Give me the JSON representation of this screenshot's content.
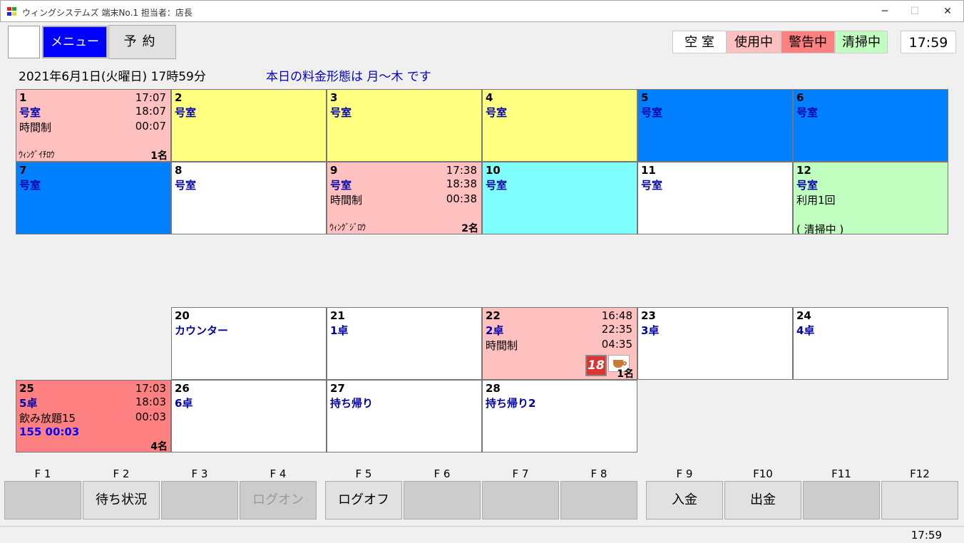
{
  "window": {
    "title": "ウィングシステムズ 端末No.1 担当者：店長",
    "minimize": "─",
    "maximize": "☐",
    "close": "✕"
  },
  "toolbar": {
    "menu_label": "メニュー",
    "reserve_label": "予約"
  },
  "legend": {
    "vacant": "空 室",
    "in_use": "使用中",
    "warning": "警告中",
    "cleaning": "清掃中"
  },
  "clock": "17:59",
  "info": {
    "date": "2021年6月1日(火曜日) 17時59分",
    "rate": "本日の料金形態は 月～木 です"
  },
  "colors": {
    "in_use": "#ffc0c0",
    "warning": "#ff8080",
    "cleaning": "#c0ffc0",
    "yellow": "#ffff80",
    "blue": "#0080ff",
    "cyan": "#80ffff",
    "vacant": "#ffffff"
  },
  "cells": [
    {
      "num": "1",
      "name": "号室",
      "plan": "時間制",
      "t1": "17:07",
      "t2": "18:07",
      "t3": "00:07",
      "customer": "ｳｨﾝｸﾞｲﾁﾛｳ",
      "people": "1名"
    },
    {
      "num": "2",
      "name": "号室"
    },
    {
      "num": "3",
      "name": "号室"
    },
    {
      "num": "4",
      "name": "号室"
    },
    {
      "num": "5",
      "name": "号室"
    },
    {
      "num": "6",
      "name": "号室"
    },
    {
      "num": "7",
      "name": "号室"
    },
    {
      "num": "8",
      "name": "号室"
    },
    {
      "num": "9",
      "name": "号室",
      "plan": "時間制",
      "t1": "17:38",
      "t2": "18:38",
      "t3": "00:38",
      "customer": "ｳｨﾝｸﾞｼﾞﾛｳ",
      "people": "2名"
    },
    {
      "num": "10",
      "name": "号室"
    },
    {
      "num": "11",
      "name": "号室"
    },
    {
      "num": "12",
      "name": "号室",
      "plan": "利用1回",
      "status": "( 清掃中 )"
    },
    {
      "num": "20",
      "name": "カウンター"
    },
    {
      "num": "21",
      "name": " 1卓"
    },
    {
      "num": "22",
      "name": " 2卓",
      "plan": "時間制",
      "t1": "16:48",
      "t2": "22:35",
      "t3": "04:35",
      "people": "1名",
      "badge": "18"
    },
    {
      "num": "23",
      "name": " 3卓"
    },
    {
      "num": "24",
      "name": " 4卓"
    },
    {
      "num": "25",
      "name": " 5卓",
      "plan": "飲み放題15",
      "extra": "155 00:03",
      "t1": "17:03",
      "t2": "18:03",
      "t3": "00:03",
      "people": "4名"
    },
    {
      "num": "26",
      "name": " 6卓"
    },
    {
      "num": "27",
      "name": "持ち帰り"
    },
    {
      "num": "28",
      "name": "持ち帰り2"
    }
  ],
  "fkeys": [
    {
      "key": "F 1",
      "label": ""
    },
    {
      "key": "F 2",
      "label": "待ち状況"
    },
    {
      "key": "F 3",
      "label": ""
    },
    {
      "key": "F 4",
      "label": "ログオン"
    },
    {
      "key": "F 5",
      "label": "ログオフ"
    },
    {
      "key": "F 6",
      "label": ""
    },
    {
      "key": "F 7",
      "label": ""
    },
    {
      "key": "F 8",
      "label": ""
    },
    {
      "key": "F 9",
      "label": "入金"
    },
    {
      "key": "F10",
      "label": "出金"
    },
    {
      "key": "F11",
      "label": ""
    },
    {
      "key": "F12",
      "label": ""
    }
  ],
  "statusbar": {
    "clock": "17:59"
  }
}
